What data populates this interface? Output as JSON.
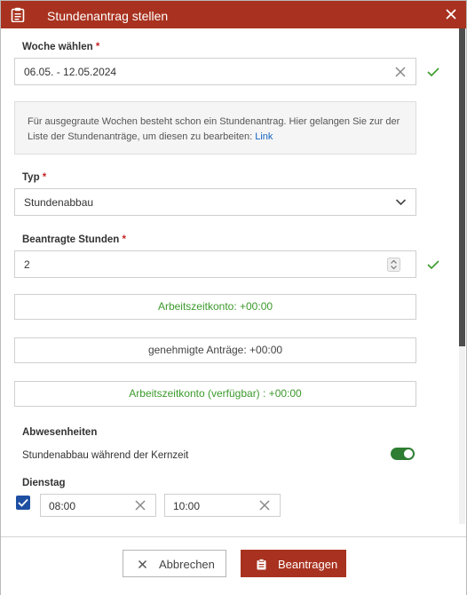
{
  "dialog": {
    "title": "Stundenantrag stellen",
    "accent_color": "#a8321f"
  },
  "week": {
    "label": "Woche wählen",
    "required_mark": "*",
    "value": "06.05. - 12.05.2024"
  },
  "info": {
    "text": "Für ausgegraute Wochen besteht schon ein Stundenantrag. Hier gelangen Sie zur der Liste der Stundenanträge, um diesen zu bearbeiten: ",
    "link_text": "Link"
  },
  "type": {
    "label": "Typ",
    "required_mark": "*",
    "value": "Stundenabbau"
  },
  "hours": {
    "label": "Beantragte Stunden",
    "required_mark": "*",
    "value": "2"
  },
  "summary": {
    "arbeitszeitkonto": "Arbeitszeitkonto: +00:00",
    "genehmigte": "genehmigte Anträge: +00:00",
    "verfuegbar": "Arbeitszeitkonto (verfügbar) : +00:00"
  },
  "absences": {
    "heading": "Abwesenheiten",
    "core_time_label": "Stundenabbau während der Kernzeit",
    "core_time_enabled": true
  },
  "day": {
    "name": "Dienstag",
    "checked": true,
    "from": "08:00",
    "to": "10:00"
  },
  "footer": {
    "cancel_label": "Abbrechen",
    "submit_label": "Beantragen"
  },
  "colors": {
    "valid_check": "#3b9a2b",
    "toggle_on": "#2e7d32",
    "checkbox": "#1f4fa3",
    "link": "#1565c0"
  }
}
